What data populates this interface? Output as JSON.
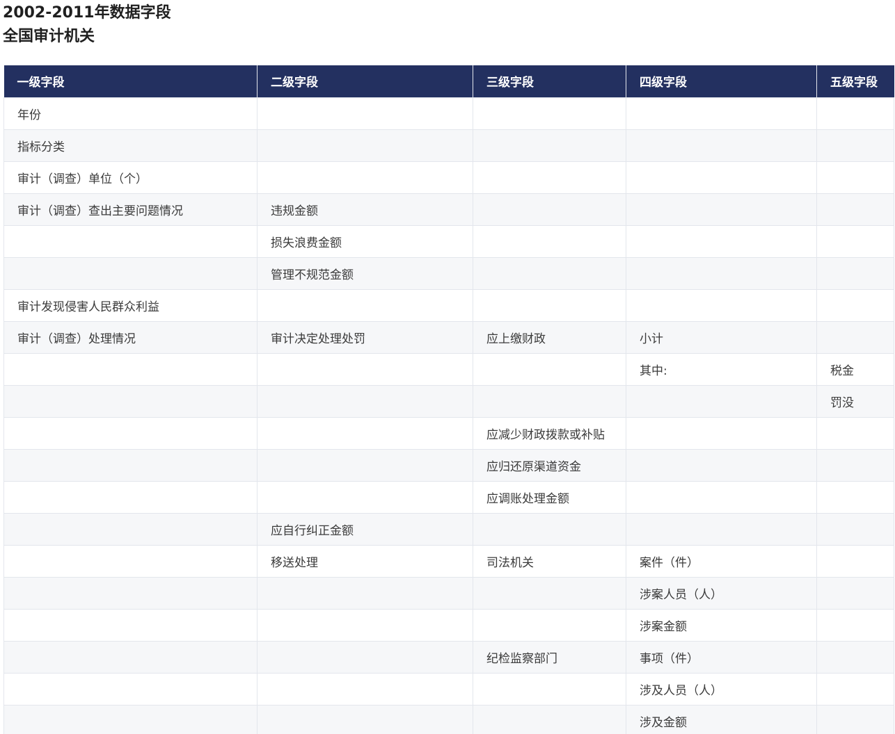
{
  "title": {
    "line1": "2002-2011年数据字段",
    "line2": "全国审计机关"
  },
  "table": {
    "headers": [
      "一级字段",
      "二级字段",
      "三级字段",
      "四级字段",
      "五级字段"
    ],
    "rows": [
      [
        "年份",
        "",
        "",
        "",
        ""
      ],
      [
        "指标分类",
        "",
        "",
        "",
        ""
      ],
      [
        "审计（调查）单位（个）",
        "",
        "",
        "",
        ""
      ],
      [
        "审计（调查）查出主要问题情况",
        "违规金额",
        "",
        "",
        ""
      ],
      [
        "",
        "损失浪费金额",
        "",
        "",
        ""
      ],
      [
        "",
        "管理不规范金额",
        "",
        "",
        ""
      ],
      [
        "审计发现侵害人民群众利益",
        "",
        "",
        "",
        ""
      ],
      [
        "审计（调查）处理情况",
        "审计决定处理处罚",
        "应上缴财政",
        "小计",
        ""
      ],
      [
        "",
        "",
        "",
        "其中:",
        "税金"
      ],
      [
        "",
        "",
        "",
        "",
        "罚没"
      ],
      [
        "",
        "",
        "应减少财政拨款或补贴",
        "",
        ""
      ],
      [
        "",
        "",
        "应归还原渠道资金",
        "",
        ""
      ],
      [
        "",
        "",
        "应调账处理金额",
        "",
        ""
      ],
      [
        "",
        "应自行纠正金额",
        "",
        "",
        ""
      ],
      [
        "",
        "移送处理",
        "司法机关",
        "案件（件）",
        ""
      ],
      [
        "",
        "",
        "",
        "涉案人员（人）",
        ""
      ],
      [
        "",
        "",
        "",
        "涉案金额",
        ""
      ],
      [
        "",
        "",
        "纪检监察部门",
        "事项（件）",
        ""
      ],
      [
        "",
        "",
        "",
        "涉及人员（人）",
        ""
      ],
      [
        "",
        "",
        "",
        "涉及金额",
        ""
      ]
    ]
  }
}
